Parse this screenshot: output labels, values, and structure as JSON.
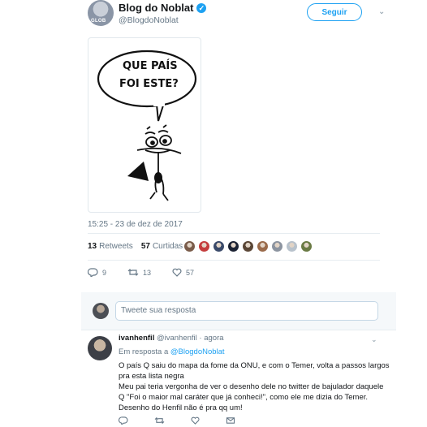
{
  "author": {
    "display_name": "Blog do Noblat",
    "handle": "@BlogdoNoblat",
    "avatar_text": "GLOB",
    "verified": true
  },
  "follow_button": "Seguir",
  "cartoon": {
    "speech_line1": "QUE PAÍS",
    "speech_line2": "FOI ESTE?"
  },
  "timestamp": "15:25 - 23 de dez de 2017",
  "stats": {
    "retweets_count": "13",
    "retweets_label": "Retweets",
    "likes_count": "57",
    "likes_label": "Curtidas",
    "liker_colors": [
      "#7a5c4a",
      "#c43d3d",
      "#3a4a6a",
      "#1b2233",
      "#5a4636",
      "#9a6a4a",
      "#8c94a0",
      "#b8c2cc",
      "#6a7a44"
    ]
  },
  "actions": {
    "replies": "9",
    "retweets": "13",
    "likes": "57"
  },
  "composer": {
    "placeholder": "Tweete sua resposta"
  },
  "reply": {
    "name": "ivanhenfil",
    "handle": "@ivanhenfil",
    "time": "· agora",
    "in_reply_prefix": "Em resposta a",
    "in_reply_mention": "@BlogdoNoblat",
    "lines": [
      "O país Q saiu do mapa da fome da ONU, e com o Temer, volta a passos largos",
      "pra esta lista negra",
      "Meu pai teria vergonha de ver o desenho dele no twitter de bajulador daquele",
      "Q \"Foi o maior mal caráter que já conheci!\", como ele me dizia do Temer.",
      "Desenho do Henfil não é pra qq um!"
    ]
  },
  "colors": {
    "accent": "#1da1f2",
    "muted": "#657786"
  }
}
